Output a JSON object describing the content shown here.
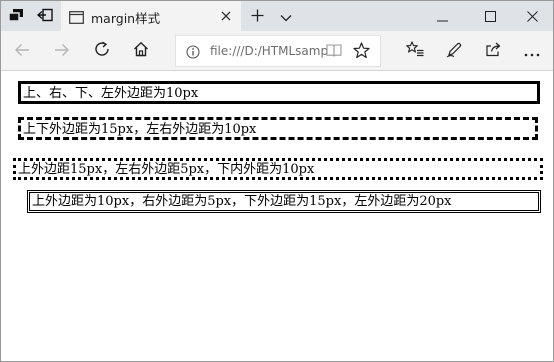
{
  "browser": {
    "tab": {
      "title": "margin样式"
    },
    "address": {
      "url": "file:///D:/HTMLsampl"
    }
  },
  "page": {
    "boxes": [
      {
        "text": "上、右、下、左外边距为10px",
        "border_style": "solid"
      },
      {
        "text": "上下外边距为15px，左右外边距为10px",
        "border_style": "dashed"
      },
      {
        "text": "上外边距15px，左右外边距5px，下内外距为10px",
        "border_style": "dotted"
      },
      {
        "text": "上外边距为10px，右外边距为5px，下外边距为15px，左外边距为20px",
        "border_style": "double"
      }
    ]
  },
  "colors": {
    "titlebar_bg": "#dfe3e8",
    "active_tab_bg": "#f3f3f3",
    "toolbar_bg": "#f3f3f3",
    "page_bg": "#ffffff",
    "border": "#000000"
  },
  "icons": [
    "tab-preview-icon",
    "tab-back-icon",
    "page-icon",
    "close-icon",
    "new-tab-plus-icon",
    "tab-list-chevron-icon",
    "minimize-icon",
    "maximize-icon",
    "window-close-icon",
    "back-arrow-icon",
    "forward-arrow-icon",
    "refresh-icon",
    "home-icon",
    "info-icon",
    "reading-view-icon",
    "favorite-star-icon",
    "favorites-list-icon",
    "notes-pen-icon",
    "share-icon",
    "more-dots-icon"
  ]
}
